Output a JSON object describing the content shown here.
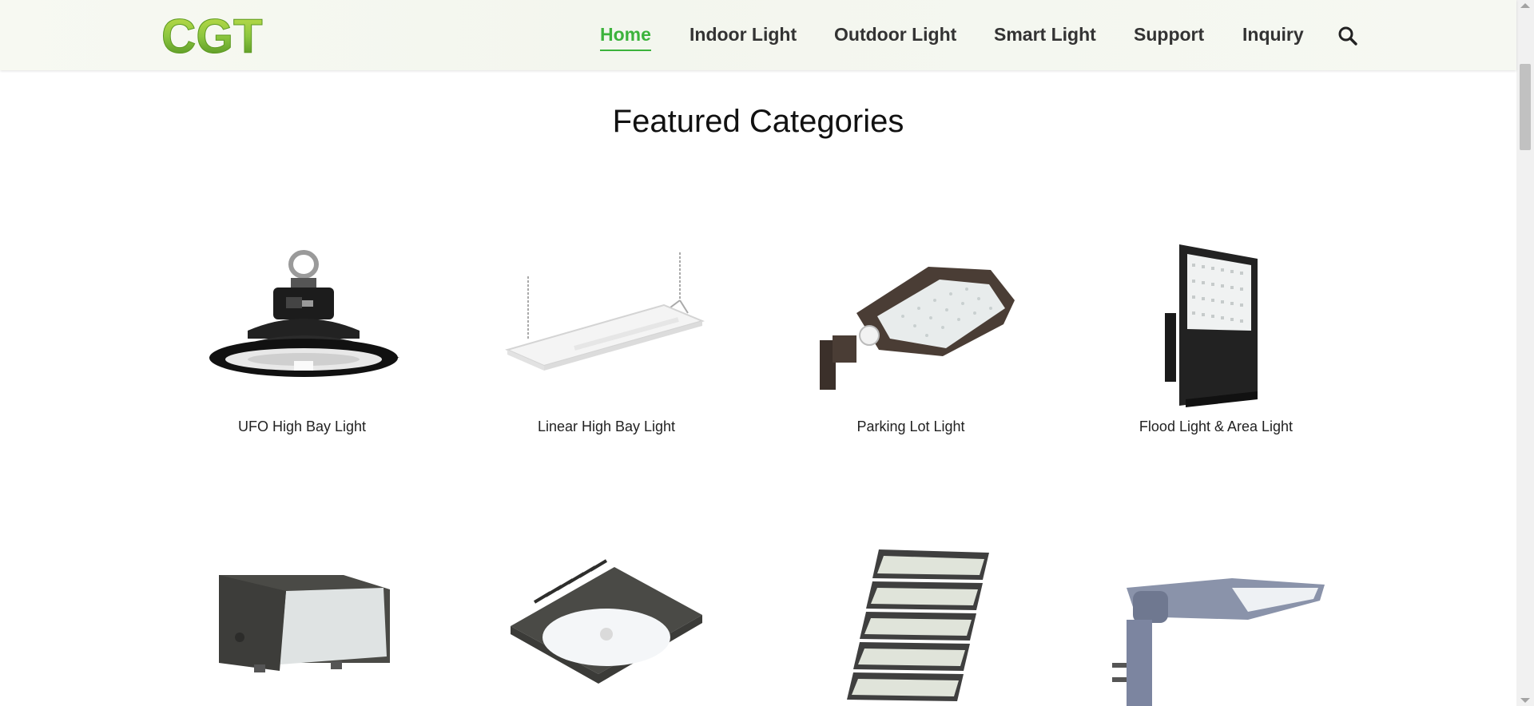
{
  "brand": {
    "logo_text": "CGT"
  },
  "nav": {
    "items": [
      {
        "label": "Home",
        "active": true
      },
      {
        "label": "Indoor Light",
        "active": false
      },
      {
        "label": "Outdoor Light",
        "active": false
      },
      {
        "label": "Smart Light",
        "active": false
      },
      {
        "label": "Support",
        "active": false
      },
      {
        "label": "Inquiry",
        "active": false
      }
    ],
    "search_icon": "search-icon"
  },
  "section": {
    "title": "Featured Categories"
  },
  "categories": [
    {
      "label": "UFO High Bay Light",
      "icon": "ufo-high-bay-light-image"
    },
    {
      "label": "Linear High Bay Light",
      "icon": "linear-high-bay-light-image"
    },
    {
      "label": "Parking Lot Light",
      "icon": "parking-lot-light-image"
    },
    {
      "label": "Flood Light & Area Light",
      "icon": "flood-light-image"
    },
    {
      "label": "",
      "icon": "wall-pack-light-image"
    },
    {
      "label": "",
      "icon": "canopy-light-image"
    },
    {
      "label": "",
      "icon": "stadium-light-image"
    },
    {
      "label": "",
      "icon": "street-light-image"
    }
  ],
  "colors": {
    "accent": "#3cb33c",
    "nav_text": "#333333",
    "logo_green": "#8cc63f"
  }
}
